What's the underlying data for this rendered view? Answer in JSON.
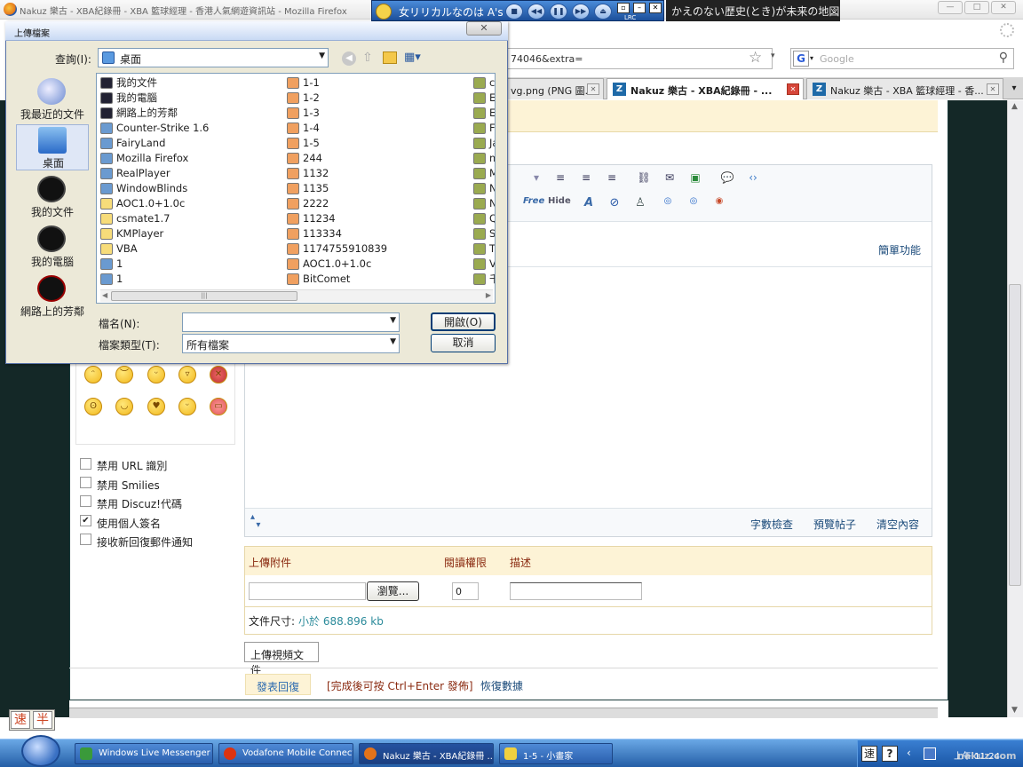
{
  "browser": {
    "window_title": "Nakuz 樂古 - XBA紀錄冊 - XBA 籃球經理 - 香港人氣網遊資訊站 - Mozilla Firefox",
    "url": "74046&extra=",
    "search_placeholder": "Google",
    "tabs": [
      {
        "label": "vg.png (PNG 圖..."
      },
      {
        "label": "Nakuz 樂古 - XBA紀錄冊 - ..."
      },
      {
        "label": "Nakuz 樂古 - XBA 籃球經理 - 香..."
      }
    ],
    "tab_menu": "▾"
  },
  "media_player": {
    "song": "女リリカルなのは A's",
    "lrc_text": "かえのない歴史(とき)が未来の地図",
    "lrc_badge": "LRC"
  },
  "dialog": {
    "title": "上傳檔案",
    "lookin_label": "查詢(I):",
    "lookin_value": "桌面",
    "places": [
      {
        "label": "我最近的文件"
      },
      {
        "label": "桌面"
      },
      {
        "label": "我的文件"
      },
      {
        "label": "我的電腦"
      },
      {
        "label": "網路上的芳鄰"
      }
    ],
    "files_col1": [
      "我的文件",
      "我的電腦",
      "網路上的芳鄰",
      "Counter-Strike 1.6",
      "FairyLand",
      "Mozilla Firefox",
      "RealPlayer",
      "WindowBlinds",
      "AOC1.0+1.0c",
      "csmate1.7",
      "KMPlayer",
      "VBA",
      "1",
      "1"
    ],
    "files_col2": [
      "1-1",
      "1-2",
      "1-3",
      "1-4",
      "1-5",
      "244",
      "1132",
      "1135",
      "2222",
      "11234",
      "113334",
      "1174755910839",
      "AOC1.0+1.0c",
      "BitComet"
    ],
    "files_col3": [
      "cc",
      "Ef",
      "Ef",
      "Fl",
      "Ja",
      "m",
      "M",
      "N",
      "N",
      "Q",
      "S",
      "Th",
      "Vi",
      "千"
    ],
    "filename_label": "檔名(N):",
    "filename_value": "",
    "filetype_label": "檔案類型(T):",
    "filetype_value": "所有檔案",
    "open_button": "開啟(O)",
    "cancel_button": "取消"
  },
  "editor": {
    "simple_mode": "簡單功能",
    "free_tag": "Free",
    "hide_tag": "Hide",
    "word_check": "字數檢查",
    "preview": "預覽帖子",
    "clear": "清空內容"
  },
  "options": [
    {
      "label": "禁用 URL 識別",
      "checked": false
    },
    {
      "label": "禁用 Smilies",
      "checked": false
    },
    {
      "label": "禁用 Discuz!代碼",
      "checked": false
    },
    {
      "label": "使用個人簽名",
      "checked": true
    },
    {
      "label": "接收新回復郵件通知",
      "checked": false
    }
  ],
  "attachment": {
    "col_upload": "上傳附件",
    "col_permission": "閱讀權限",
    "col_desc": "描述",
    "browse_button": "瀏覽...",
    "permission_value": "0",
    "size_label": "文件尺寸:",
    "size_value": "小於 688.896 kb",
    "video_button": "上傳視頻文件"
  },
  "footer": {
    "submit": "發表回復",
    "hint": "[完成後可按 Ctrl+Enter 發佈]",
    "restore": "恢復數據"
  },
  "ime": {
    "a": "速",
    "b": "半"
  },
  "taskbar": {
    "items": [
      {
        "label": "Windows Live Messenger"
      },
      {
        "label": "Vodafone Mobile Connect ..."
      },
      {
        "label": "Nakuz 樂古 - XBA紀錄冊 ..."
      },
      {
        "label": "1-5 - 小畫家"
      }
    ],
    "tray_ime": "速",
    "tray_help": "?",
    "clock": "上午 11:24",
    "watermark": "nakuz.com"
  },
  "colors": {
    "accent_blue": "#245ea6",
    "cream": "#fdf3d6",
    "dark_side": "#142827",
    "label_red": "#8a2a10",
    "link_teal": "#2a8a9a"
  }
}
